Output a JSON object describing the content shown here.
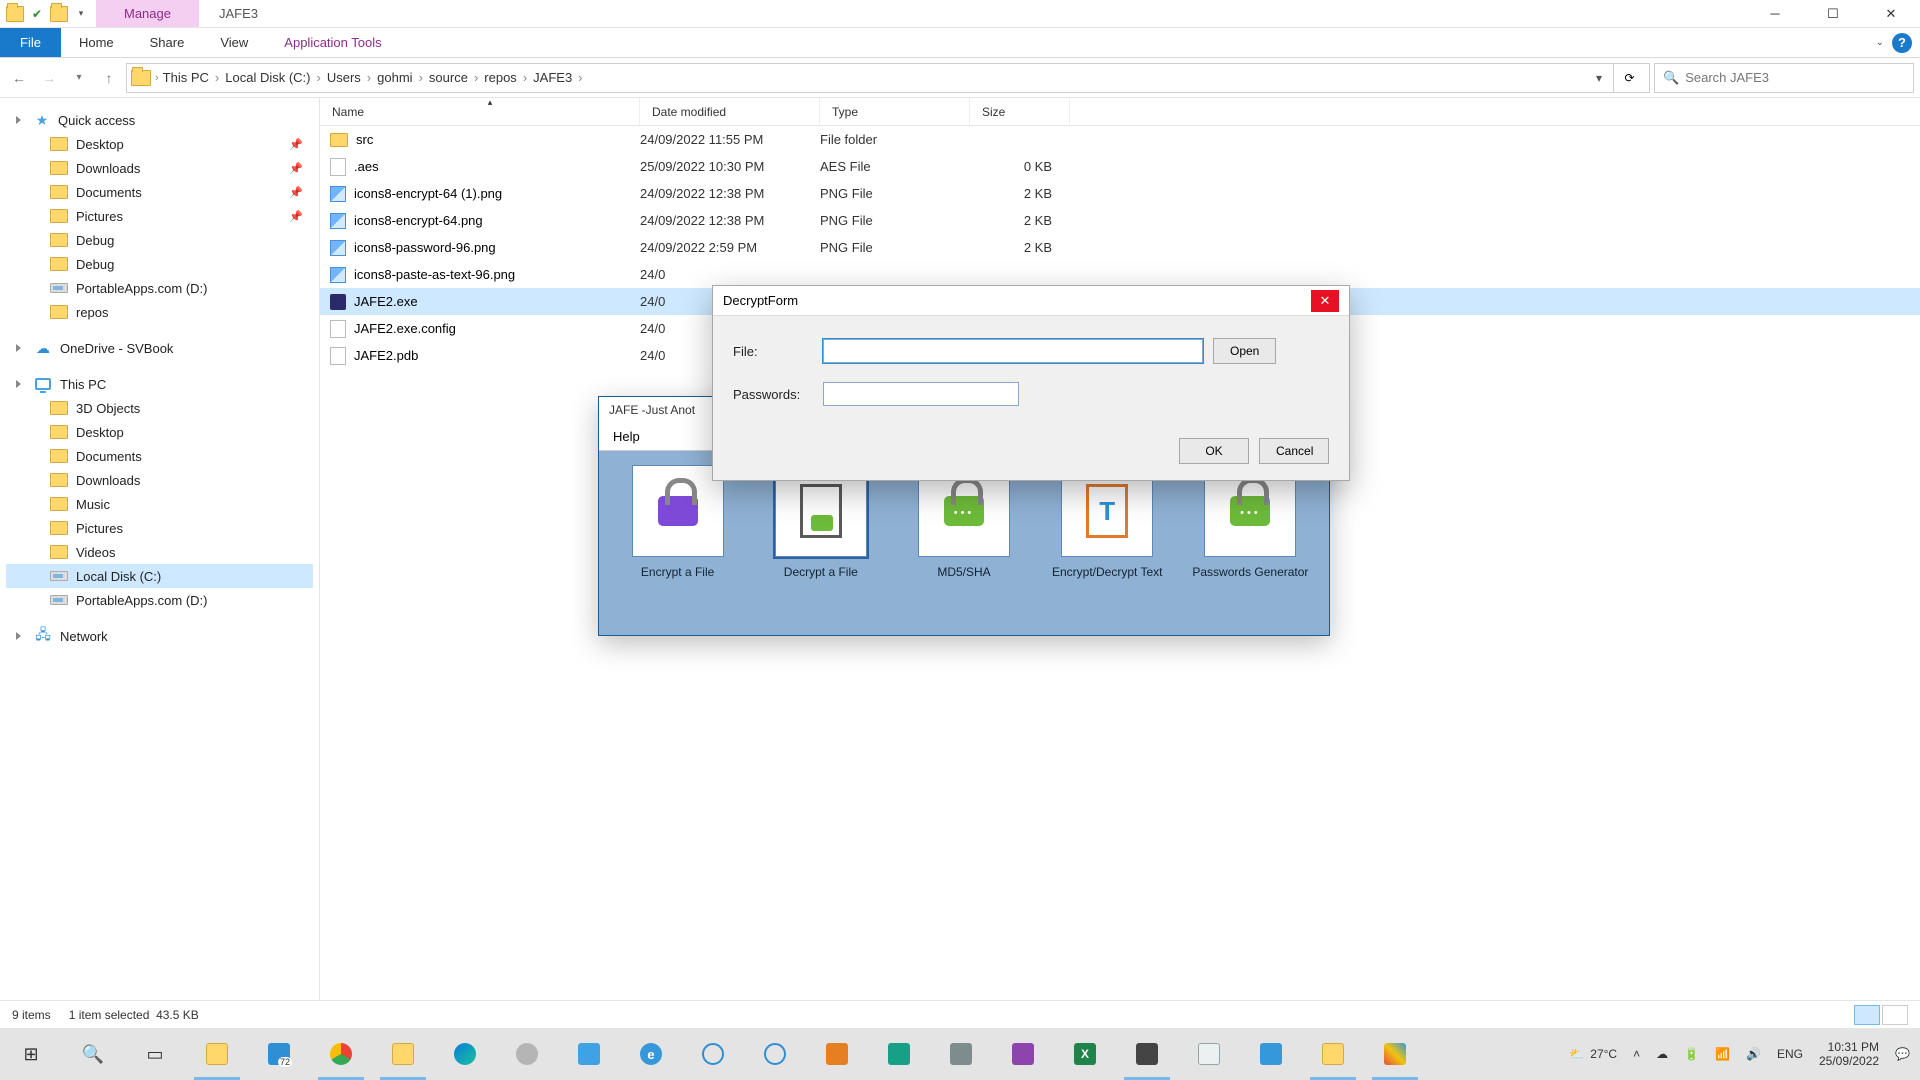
{
  "window": {
    "manage_tab": "Manage",
    "app_title": "JAFE3"
  },
  "ribbon": {
    "file": "File",
    "home": "Home",
    "share": "Share",
    "view": "View",
    "tools": "Application Tools"
  },
  "breadcrumbs": [
    "This PC",
    "Local Disk (C:)",
    "Users",
    "gohmi",
    "source",
    "repos",
    "JAFE3"
  ],
  "search": {
    "placeholder": "Search JAFE3"
  },
  "sidebar": {
    "quick_access": "Quick access",
    "quick_items": [
      {
        "label": "Desktop",
        "pinned": true
      },
      {
        "label": "Downloads",
        "pinned": true
      },
      {
        "label": "Documents",
        "pinned": true
      },
      {
        "label": "Pictures",
        "pinned": true
      },
      {
        "label": "Debug",
        "pinned": false
      },
      {
        "label": "Debug",
        "pinned": false
      },
      {
        "label": "PortableApps.com (D:)",
        "pinned": false
      },
      {
        "label": "repos",
        "pinned": false
      }
    ],
    "onedrive": "OneDrive - SVBook",
    "this_pc": "This PC",
    "pc_items": [
      "3D Objects",
      "Desktop",
      "Documents",
      "Downloads",
      "Music",
      "Pictures",
      "Videos",
      "Local Disk (C:)",
      "PortableApps.com (D:)"
    ],
    "network": "Network"
  },
  "columns": {
    "name": "Name",
    "date": "Date modified",
    "type": "Type",
    "size": "Size"
  },
  "files": [
    {
      "icon": "folder",
      "name": "src",
      "date": "24/09/2022 11:55 PM",
      "type": "File folder",
      "size": ""
    },
    {
      "icon": "file",
      "name": ".aes",
      "date": "25/09/2022 10:30 PM",
      "type": "AES File",
      "size": "0 KB"
    },
    {
      "icon": "img",
      "name": "icons8-encrypt-64 (1).png",
      "date": "24/09/2022 12:38 PM",
      "type": "PNG File",
      "size": "2 KB"
    },
    {
      "icon": "img",
      "name": "icons8-encrypt-64.png",
      "date": "24/09/2022 12:38 PM",
      "type": "PNG File",
      "size": "2 KB"
    },
    {
      "icon": "img",
      "name": "icons8-password-96.png",
      "date": "24/09/2022 2:59 PM",
      "type": "PNG File",
      "size": "2 KB"
    },
    {
      "icon": "img",
      "name": "icons8-paste-as-text-96.png",
      "date": "24/0",
      "type": "",
      "size": ""
    },
    {
      "icon": "exe",
      "name": "JAFE2.exe",
      "date": "24/0",
      "type": "",
      "size": "",
      "selected": true
    },
    {
      "icon": "file",
      "name": "JAFE2.exe.config",
      "date": "24/0",
      "type": "",
      "size": ""
    },
    {
      "icon": "file",
      "name": "JAFE2.pdb",
      "date": "24/0",
      "type": "",
      "size": ""
    }
  ],
  "status": {
    "items": "9 items",
    "selected": "1 item selected",
    "size": "43.5 KB"
  },
  "jafe": {
    "title": "JAFE -Just Anot",
    "menu_help": "Help",
    "actions": [
      "Encrypt a File",
      "Decrypt a File",
      "MD5/SHA",
      "Encrypt/Decrypt Text",
      "Passwords Generator"
    ]
  },
  "dialog": {
    "title": "DecryptForm",
    "file_label": "File:",
    "passwords_label": "Passwords:",
    "open": "Open",
    "ok": "OK",
    "cancel": "Cancel",
    "file_value": "",
    "pw_value": ""
  },
  "systray": {
    "temp": "27°C",
    "badge": "72",
    "lang": "ENG",
    "time": "10:31 PM",
    "date": "25/09/2022"
  }
}
